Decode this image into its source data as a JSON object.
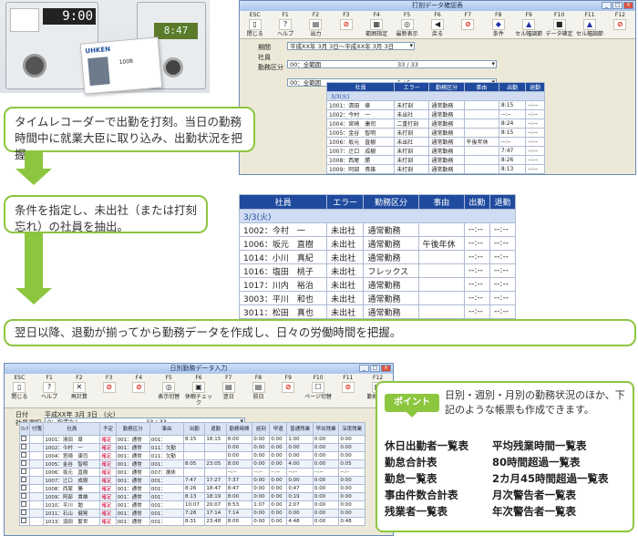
{
  "photo": {
    "clock_time": "9:00",
    "clock2_time": "8:47",
    "card_brand": "UKEN",
    "card_id": "1008",
    "card_logo": "UHKEN"
  },
  "steps": [
    "タイムレコーダーで出勤を打刻。当日の勤務時間中に就業大臣に取り込み、出勤状況を把握。",
    "条件を指定し、未出社（または打刻忘れ）の社員を抽出。",
    "翌日以降、退勤が揃ってから勤務データを作成し、日々の労働時間を把握。"
  ],
  "win1": {
    "title": "打刻データ確認表",
    "fkeys": [
      {
        "key": "ESC",
        "label": "閉じる",
        "icon": "door-icon",
        "glyph": "▯"
      },
      {
        "key": "F1",
        "label": "ヘルプ",
        "icon": "help-icon",
        "glyph": "?"
      },
      {
        "key": "F2",
        "label": "出力",
        "icon": "print-icon",
        "glyph": "▤"
      },
      {
        "key": "F3",
        "label": "",
        "icon": "no-icon",
        "glyph": "⊘"
      },
      {
        "key": "F4",
        "label": "範囲指定",
        "icon": "range-icon",
        "glyph": "▦"
      },
      {
        "key": "F5",
        "label": "最新表示",
        "icon": "refresh-icon",
        "glyph": "◎"
      },
      {
        "key": "F6",
        "label": "戻る",
        "icon": "back-icon",
        "glyph": "◀"
      },
      {
        "key": "F7",
        "label": "",
        "icon": "no-icon",
        "glyph": "⊘"
      },
      {
        "key": "F8",
        "label": "条件",
        "icon": "filter-icon",
        "glyph": "◆"
      },
      {
        "key": "F9",
        "label": "セル幅調節",
        "icon": "width-icon",
        "glyph": "▲"
      },
      {
        "key": "F10",
        "label": "データ確定",
        "icon": "confirm-icon",
        "glyph": "■"
      },
      {
        "key": "F11",
        "label": "セル幅調節",
        "icon": "bell-icon",
        "glyph": "▲"
      },
      {
        "key": "F12",
        "label": "",
        "icon": "no-icon",
        "glyph": "⊘"
      }
    ],
    "period_label": "期間",
    "period_value": "平成XX年 3月 3日～平成XX年 3月 3日",
    "emp_label": "社員",
    "emp_value": "00：全範囲",
    "emp_count": "33 / 33",
    "div_label": "勤務区分",
    "div_value": "00：全範囲",
    "div_count": "5 / 5",
    "headers": [
      "社員",
      "エラー",
      "勤務区分",
      "事由",
      "出勤",
      "退勤"
    ],
    "date_row": "3/3(火)",
    "rows": [
      [
        "1001：清田　章",
        "未打刻",
        "通常勤務",
        "",
        "8:15",
        "--:--"
      ],
      [
        "1002：今村　一",
        "未出社",
        "通常勤務",
        "",
        "--:--",
        "--:--"
      ],
      [
        "1004：宮崎　康司",
        "二重打刻",
        "通常勤務",
        "",
        "8:24",
        "--:--"
      ],
      [
        "1005：金谷　智明",
        "未打刻",
        "通常勤務",
        "",
        "8:15",
        "--:--"
      ],
      [
        "1006：坂元　直樹",
        "未出社",
        "通常勤務",
        "午後年休",
        "--:--",
        "--:--"
      ],
      [
        "1007：辻口　成樹",
        "未打刻",
        "通常勤務",
        "",
        "7:47",
        "--:--"
      ],
      [
        "1008：西尾　勝",
        "未打刻",
        "通常勤務",
        "",
        "8:26",
        "--:--"
      ],
      [
        "1009：阿部　貴雄",
        "未打刻",
        "通常勤務",
        "",
        "8:13",
        "--:--"
      ],
      [
        "1010：平川　勉",
        "未打刻",
        "通常勤務",
        "",
        "10:07",
        "--:--"
      ]
    ]
  },
  "big_table": {
    "headers": [
      "社員",
      "エラー",
      "勤務区分",
      "事由",
      "出勤",
      "退勤"
    ],
    "date_row": "3/3(火)",
    "rows": [
      [
        "1002：今村　一",
        "未出社",
        "通常勤務",
        "",
        "--:--",
        "--:--"
      ],
      [
        "1006：坂元　直樹",
        "未出社",
        "通常勤務",
        "午後年休",
        "--:--",
        "--:--"
      ],
      [
        "1014：小川　真紀",
        "未出社",
        "通常勤務",
        "",
        "--:--",
        "--:--"
      ],
      [
        "1016：塩田　桃子",
        "未出社",
        "フレックス",
        "",
        "--:--",
        "--:--"
      ],
      [
        "1017：川内　裕治",
        "未出社",
        "通常勤務",
        "",
        "--:--",
        "--:--"
      ],
      [
        "3003：平川　和也",
        "未出社",
        "通常勤務",
        "",
        "--:--",
        "--:--"
      ],
      [
        "3011：松田　真也",
        "未出社",
        "通常勤務",
        "",
        "--:--",
        "--:--"
      ]
    ]
  },
  "win2": {
    "title": "日別勤務データ入力",
    "fkeys": [
      {
        "key": "ESC",
        "label": "閉じる",
        "icon": "door-icon",
        "glyph": "▯"
      },
      {
        "key": "F1",
        "label": "ヘルプ",
        "icon": "help-icon",
        "glyph": "?"
      },
      {
        "key": "F2",
        "label": "再計算",
        "icon": "calc-icon",
        "glyph": "✕"
      },
      {
        "key": "F3",
        "label": "",
        "icon": "no-icon",
        "glyph": "⊘"
      },
      {
        "key": "F4",
        "label": "",
        "icon": "no-icon",
        "glyph": "⊘"
      },
      {
        "key": "F5",
        "label": "表示切替",
        "icon": "view-icon",
        "glyph": "◎"
      },
      {
        "key": "F6",
        "label": "休暇チェック",
        "icon": "check-icon",
        "glyph": "▣"
      },
      {
        "key": "F7",
        "label": "翌日",
        "icon": "next-icon",
        "glyph": "▤"
      },
      {
        "key": "F8",
        "label": "前日",
        "icon": "prev-icon",
        "glyph": "▤"
      },
      {
        "key": "F9",
        "label": "",
        "icon": "no-icon",
        "glyph": "⊘"
      },
      {
        "key": "F10",
        "label": "ページ切替",
        "icon": "page-icon",
        "glyph": "☐"
      },
      {
        "key": "F11",
        "label": "",
        "icon": "no-icon",
        "glyph": "⊘"
      },
      {
        "key": "F12",
        "label": "勤務登録",
        "icon": "register-icon",
        "glyph": "▦"
      }
    ],
    "date_label": "日付",
    "date_value": "平成XX年 3月 3日　(火)",
    "emp_label": "社員選択",
    "emp_value": "0：指定なし",
    "emp_count": "33 / 33",
    "headers": [
      "ﾛｯｸ",
      "付箋",
      "社員",
      "予定",
      "勤務区分",
      "事由",
      "出勤",
      "退勤",
      "勤務時間",
      "遅刻",
      "早退",
      "普通残業",
      "早出残業",
      "深夜残業"
    ],
    "rows": [
      [
        "",
        "",
        "1001：清田　章",
        "確定",
        "001：通常",
        "001：",
        "8:15",
        "18:15",
        "8:00",
        "0:00",
        "0:00",
        "1:00",
        "0:00",
        "0:00"
      ],
      [
        "",
        "",
        "1002：今村　一",
        "確定",
        "001：通常",
        "011：欠勤",
        "",
        "",
        "0:00",
        "0:00",
        "0:00",
        "0:00",
        "0:00",
        "0:00"
      ],
      [
        "",
        "",
        "1004：宮崎　康司",
        "確定",
        "001：通常",
        "011：欠勤",
        "",
        "",
        "0:00",
        "0:00",
        "0:00",
        "0:00",
        "0:00",
        "0:00"
      ],
      [
        "",
        "",
        "1005：金谷　智明",
        "確定",
        "001：通常",
        "001：",
        "8:05",
        "23:05",
        "8:00",
        "0:00",
        "0:00",
        "4:00",
        "0:00",
        "0:05"
      ],
      [
        "",
        "",
        "1006：坂元　直樹",
        "確定",
        "001：通常",
        "007：振休",
        "",
        "",
        "--:--",
        "--:--",
        "--:--",
        "--:--",
        "--:--",
        "--:--"
      ],
      [
        "",
        "",
        "1007：辻口　成樹",
        "確定",
        "001：通常",
        "001：",
        "7:47",
        "17:27",
        "7:37",
        "0:00",
        "0:00",
        "0:00",
        "0:00",
        "0:00"
      ],
      [
        "",
        "",
        "1008：西尾　勝",
        "確定",
        "001：通常",
        "001：",
        "8:26",
        "18:47",
        "8:47",
        "0:00",
        "0:00",
        "0:47",
        "0:00",
        "0:00"
      ],
      [
        "",
        "",
        "1009：阿部　貴雄",
        "確定",
        "001：通常",
        "001：",
        "8:13",
        "18:19",
        "8:00",
        "0:00",
        "0:00",
        "0:19",
        "0:00",
        "0:00"
      ],
      [
        "",
        "",
        "1010：平川　勉",
        "確定",
        "001：通常",
        "001：",
        "10:07",
        "20:07",
        "8:53",
        "1:07",
        "0:00",
        "2:07",
        "0:00",
        "0:00"
      ],
      [
        "",
        "",
        "1011：石山　健晃",
        "確定",
        "001：通常",
        "001：",
        "7:28",
        "17:14",
        "7:14",
        "0:00",
        "0:00",
        "0:00",
        "0:00",
        "0:00"
      ],
      [
        "",
        "",
        "1013：須田　繁世",
        "確定",
        "001：通常",
        "001：",
        "8:31",
        "23:48",
        "8:00",
        "0:00",
        "0:00",
        "4:48",
        "0:00",
        "0:48"
      ]
    ]
  },
  "point": {
    "tag": "ポイント",
    "desc": "日別・週別・月別の勤務状況のほか、下記のような帳票も作成できます。",
    "reports_left": [
      "休日出勤者一覧表",
      "勤怠合計表",
      "勤怠一覧表",
      "事由件数合計表",
      "残業者一覧表"
    ],
    "reports_right": [
      "平均残業時間一覧表",
      "80時間超過一覧表",
      "2カ月45時間超過一覧表",
      "月次警告者一覧表",
      "年次警告者一覧表"
    ]
  }
}
